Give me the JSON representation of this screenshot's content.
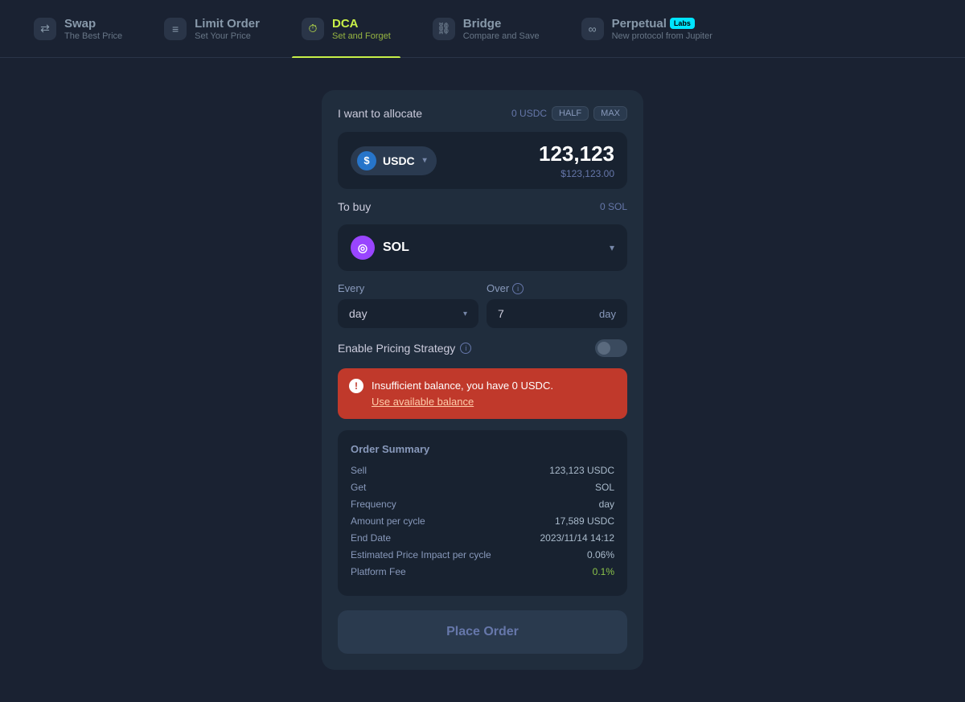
{
  "nav": {
    "items": [
      {
        "id": "swap",
        "label": "Swap",
        "sub": "The Best Price",
        "icon": "⇄",
        "active": false
      },
      {
        "id": "limit",
        "label": "Limit Order",
        "sub": "Set Your Price",
        "icon": "≡",
        "active": false
      },
      {
        "id": "dca",
        "label": "DCA",
        "sub": "Set and Forget",
        "icon": "⏱",
        "active": true
      },
      {
        "id": "bridge",
        "label": "Bridge",
        "sub": "Compare and Save",
        "icon": "⛓",
        "active": false
      },
      {
        "id": "perpetual",
        "label": "Perpetual",
        "sub": "New protocol from Jupiter",
        "icon": "∞",
        "active": false,
        "badge": "Labs"
      }
    ]
  },
  "form": {
    "allocate_label": "I want to allocate",
    "balance_text": "0 USDC",
    "half_label": "HALF",
    "max_label": "MAX",
    "token_from": "USDC",
    "amount": "123,123",
    "amount_usd": "$123,123.00",
    "to_buy_label": "To buy",
    "to_buy_balance": "0 SOL",
    "token_to": "SOL",
    "every_label": "Every",
    "over_label": "Over",
    "every_value": "day",
    "over_number": "7",
    "over_unit": "day",
    "pricing_label": "Enable Pricing Strategy",
    "error_message": "Insufficient balance, you have 0 USDC.",
    "error_link": "Use available balance",
    "summary_title": "Order Summary",
    "summary": [
      {
        "key": "Sell",
        "value": "123,123 USDC",
        "green": false
      },
      {
        "key": "Get",
        "value": "SOL",
        "green": false
      },
      {
        "key": "Frequency",
        "value": "day",
        "green": false
      },
      {
        "key": "Amount per cycle",
        "value": "17,589 USDC",
        "green": false
      },
      {
        "key": "End Date",
        "value": "2023/11/14 14:12",
        "green": false
      },
      {
        "key": "Estimated Price Impact per cycle",
        "value": "0.06%",
        "green": false
      },
      {
        "key": "Platform Fee",
        "value": "0.1%",
        "green": true
      }
    ],
    "place_order_label": "Place Order"
  }
}
